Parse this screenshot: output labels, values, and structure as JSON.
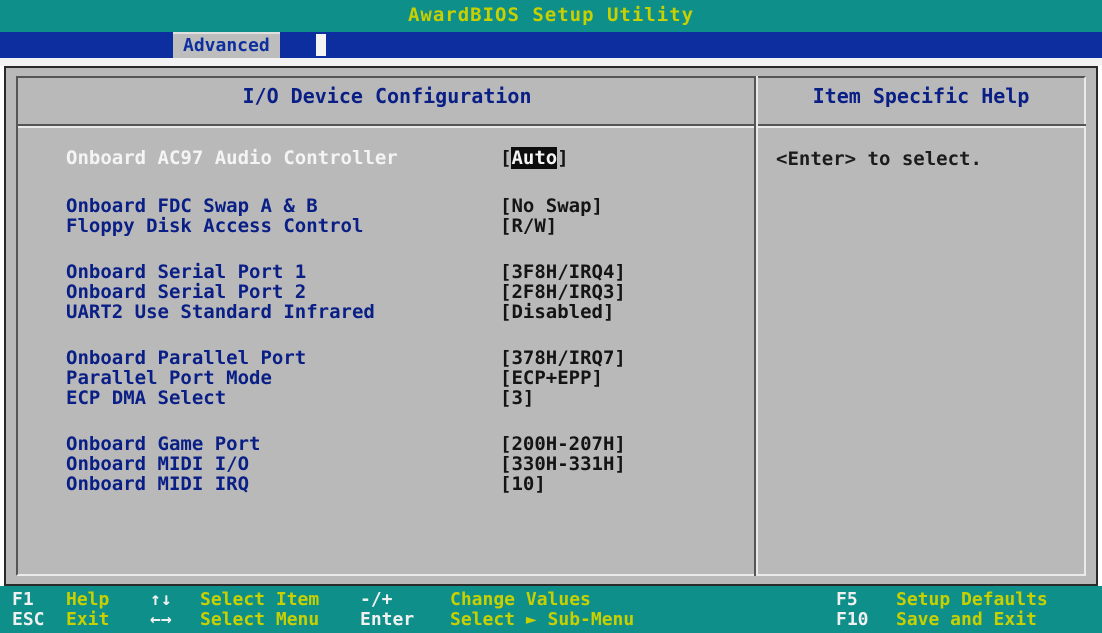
{
  "header": {
    "title": "AwardBIOS Setup Utility",
    "active_menu": "Advanced"
  },
  "panel": {
    "title": "I/O Device Configuration",
    "help_title": "Item Specific Help",
    "help_text": "<Enter> to select."
  },
  "items": [
    {
      "label": "Onboard AC97 Audio Controller",
      "value": "Auto",
      "selected": true
    },
    {
      "label": "Onboard FDC Swap A & B",
      "value": "[No Swap]"
    },
    {
      "label": "Floppy Disk Access Control",
      "value": "[R/W]"
    },
    {
      "label": "Onboard Serial Port 1",
      "value": "[3F8H/IRQ4]"
    },
    {
      "label": "Onboard Serial Port 2",
      "value": "[2F8H/IRQ3]"
    },
    {
      "label": "UART2 Use Standard Infrared",
      "value": "[Disabled]"
    },
    {
      "label": "Onboard Parallel Port",
      "value": "[378H/IRQ7]"
    },
    {
      "label": "Parallel Port Mode",
      "value": "[ECP+EPP]"
    },
    {
      "label": "ECP DMA Select",
      "value": "[3]"
    },
    {
      "label": "Onboard Game Port",
      "value": "[200H-207H]"
    },
    {
      "label": "Onboard MIDI I/O",
      "value": "[330H-331H]"
    },
    {
      "label": "Onboard MIDI IRQ",
      "value": "[10]"
    }
  ],
  "footer": {
    "keys": [
      {
        "key": "F1",
        "desc": "Help"
      },
      {
        "key": "ESC",
        "desc": "Exit"
      },
      {
        "key": "↑↓",
        "desc": "Select Item"
      },
      {
        "key": "←→",
        "desc": "Select Menu"
      },
      {
        "key": "-/+",
        "desc": "Change Values"
      },
      {
        "key": "Enter",
        "desc": "Select ► Sub-Menu"
      },
      {
        "key": "F5",
        "desc": "Setup Defaults"
      },
      {
        "key": "F10",
        "desc": "Save and Exit"
      }
    ]
  },
  "colors": {
    "title_bar": "#0e8f8a",
    "menu_bar": "#0c2e9e",
    "panel": "#b9b9b9",
    "label_text": "#0a1f86",
    "highlight": "#0d0d0d"
  }
}
